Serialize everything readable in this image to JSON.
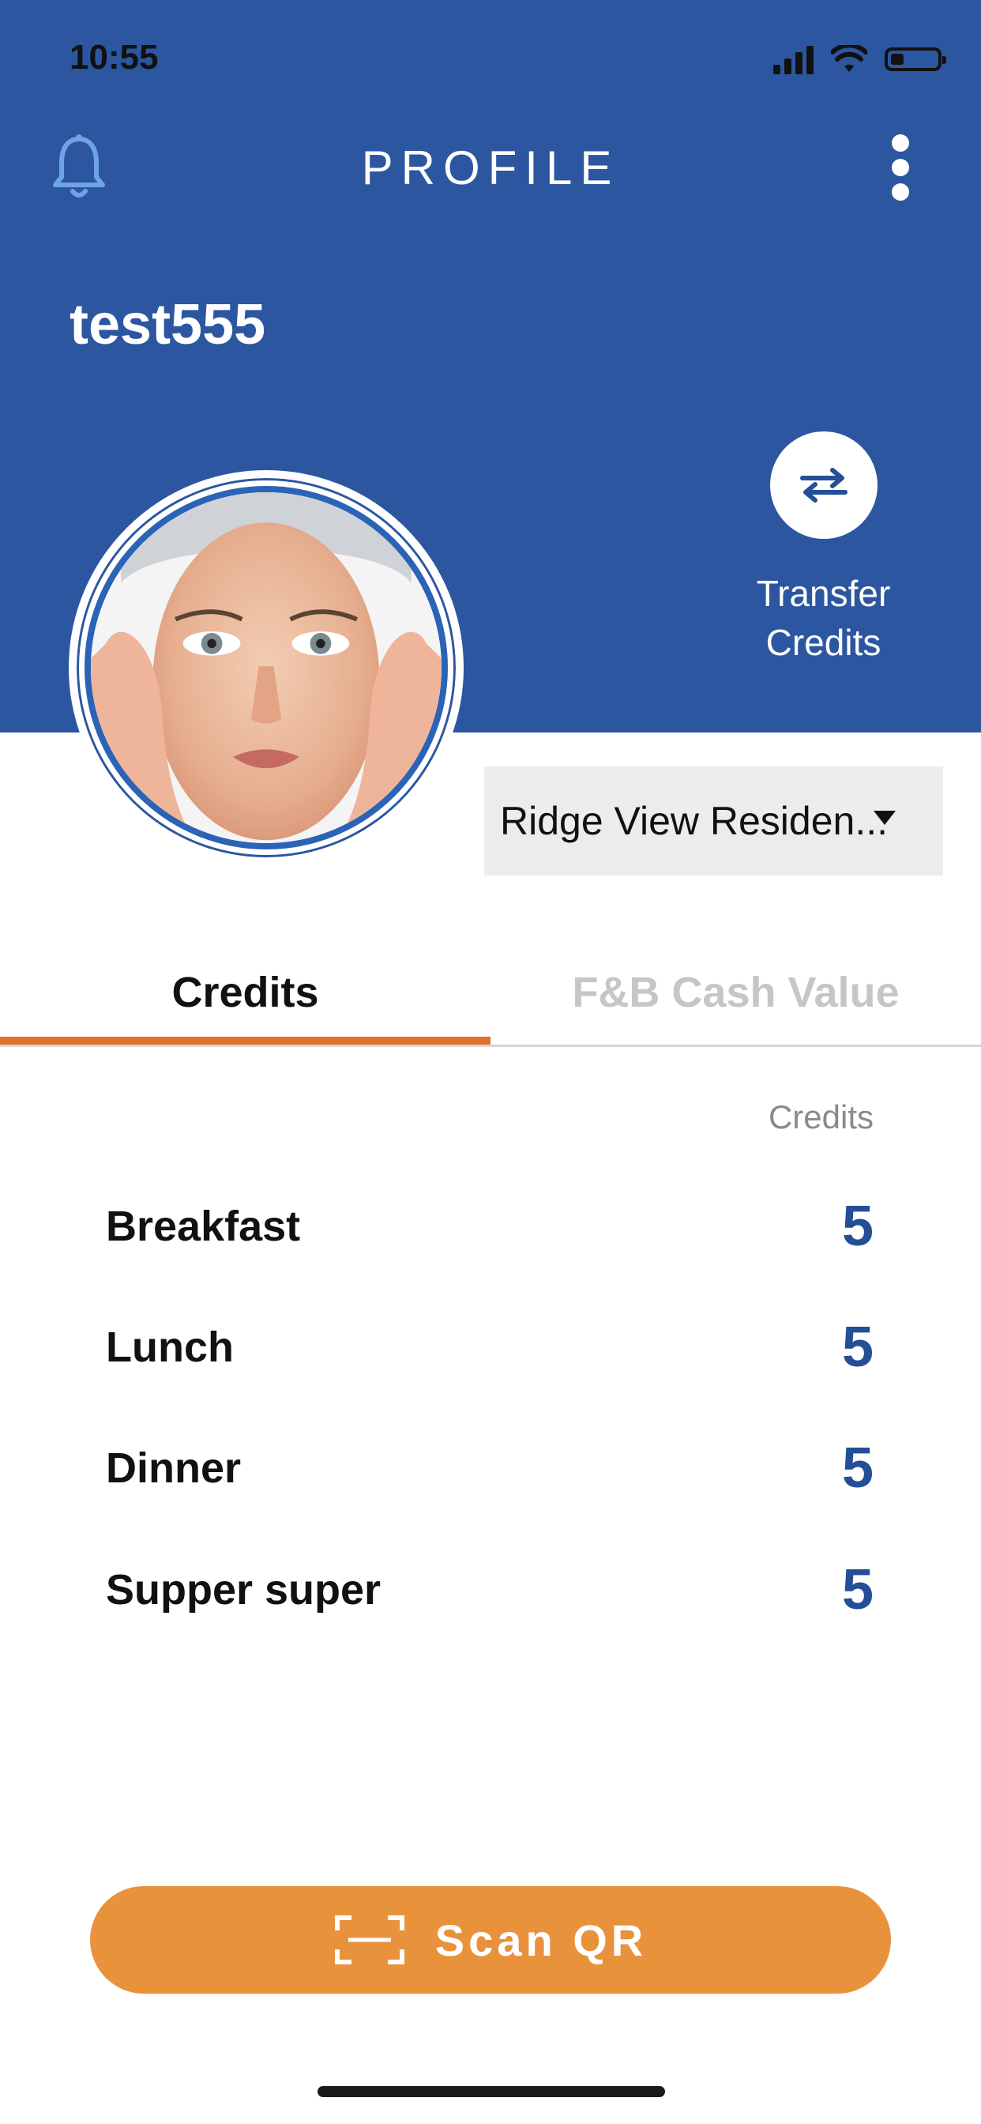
{
  "status_bar": {
    "time": "10:55"
  },
  "header": {
    "title": "PROFILE",
    "username": "test555"
  },
  "transfer": {
    "label_line1": "Transfer",
    "label_line2": "Credits"
  },
  "property_select": {
    "value": "Ridge View Residen..."
  },
  "tabs": [
    {
      "label": "Credits",
      "active": true
    },
    {
      "label": "F&B Cash Value",
      "active": false
    }
  ],
  "credits_table": {
    "column_header": "Credits",
    "rows": [
      {
        "label": "Breakfast",
        "value": "5"
      },
      {
        "label": "Lunch",
        "value": "5"
      },
      {
        "label": "Dinner",
        "value": "5"
      },
      {
        "label": "Supper super",
        "value": "5"
      }
    ]
  },
  "scan_button": {
    "label": "Scan QR"
  },
  "colors": {
    "header_bg": "#2c56a0",
    "accent_orange": "#e9923c",
    "tab_indicator": "#e2702a",
    "value_blue": "#244f96"
  },
  "icons": [
    "bell-icon",
    "more-vertical-icon",
    "transfer-arrows-icon",
    "qr-scan-icon",
    "caret-down-icon"
  ]
}
